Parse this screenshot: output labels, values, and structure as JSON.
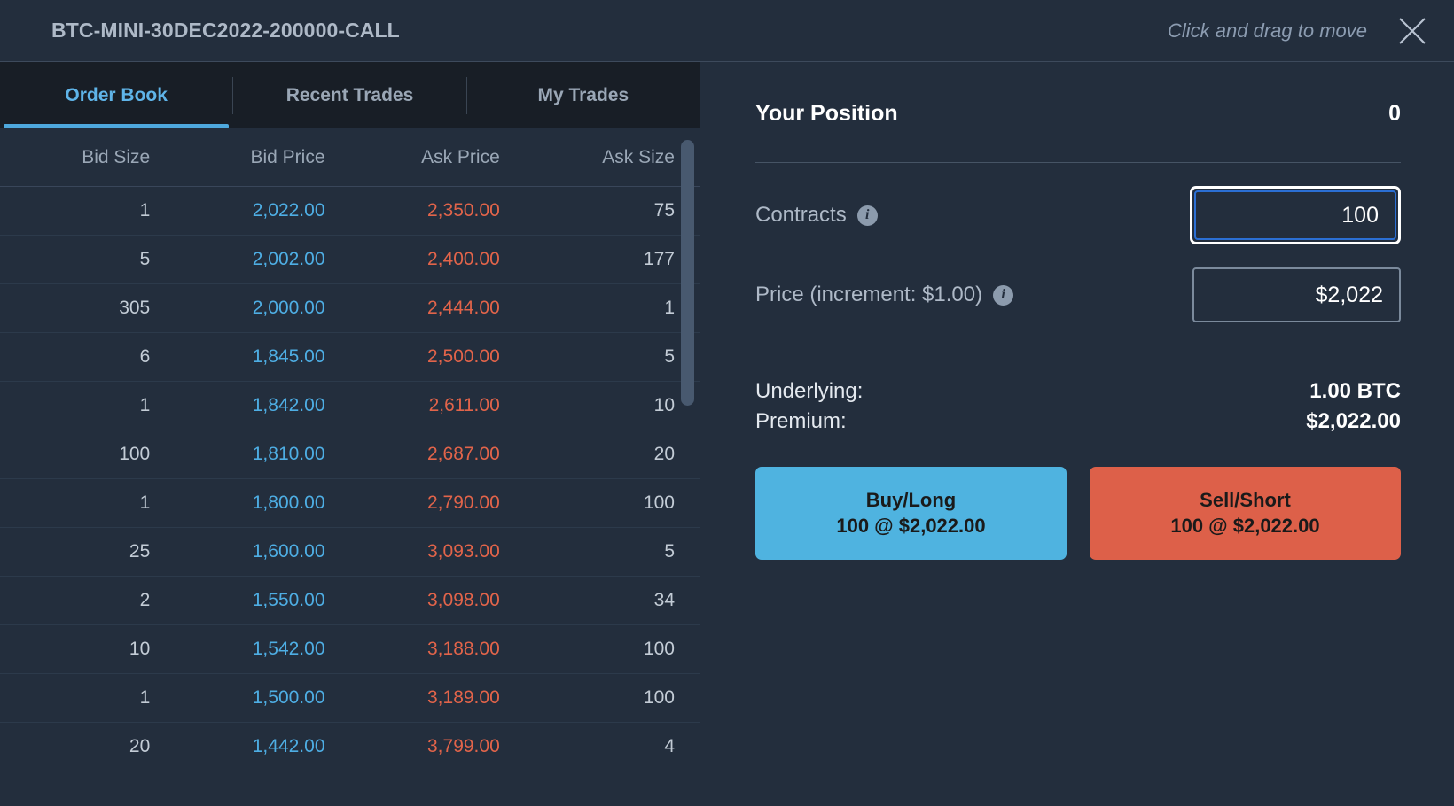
{
  "titlebar": {
    "instrument": "BTC-MINI-30DEC2022-200000-CALL",
    "drag_hint": "Click and drag to move",
    "close_icon": "close-icon"
  },
  "tabs": [
    {
      "label": "Order Book",
      "active": true
    },
    {
      "label": "Recent Trades",
      "active": false
    },
    {
      "label": "My Trades",
      "active": false
    }
  ],
  "order_book": {
    "columns": [
      "Bid Size",
      "Bid Price",
      "Ask Price",
      "Ask Size"
    ],
    "rows": [
      {
        "bid_size": "1",
        "bid_price": "2,022.00",
        "ask_price": "2,350.00",
        "ask_size": "75"
      },
      {
        "bid_size": "5",
        "bid_price": "2,002.00",
        "ask_price": "2,400.00",
        "ask_size": "177"
      },
      {
        "bid_size": "305",
        "bid_price": "2,000.00",
        "ask_price": "2,444.00",
        "ask_size": "1"
      },
      {
        "bid_size": "6",
        "bid_price": "1,845.00",
        "ask_price": "2,500.00",
        "ask_size": "5"
      },
      {
        "bid_size": "1",
        "bid_price": "1,842.00",
        "ask_price": "2,611.00",
        "ask_size": "10"
      },
      {
        "bid_size": "100",
        "bid_price": "1,810.00",
        "ask_price": "2,687.00",
        "ask_size": "20"
      },
      {
        "bid_size": "1",
        "bid_price": "1,800.00",
        "ask_price": "2,790.00",
        "ask_size": "100"
      },
      {
        "bid_size": "25",
        "bid_price": "1,600.00",
        "ask_price": "3,093.00",
        "ask_size": "5"
      },
      {
        "bid_size": "2",
        "bid_price": "1,550.00",
        "ask_price": "3,098.00",
        "ask_size": "34"
      },
      {
        "bid_size": "10",
        "bid_price": "1,542.00",
        "ask_price": "3,188.00",
        "ask_size": "100"
      },
      {
        "bid_size": "1",
        "bid_price": "1,500.00",
        "ask_price": "3,189.00",
        "ask_size": "100"
      },
      {
        "bid_size": "20",
        "bid_price": "1,442.00",
        "ask_price": "3,799.00",
        "ask_size": "4"
      }
    ]
  },
  "ticket": {
    "position_label": "Your Position",
    "position_value": "0",
    "contracts_label": "Contracts",
    "contracts_value": "100",
    "price_label": "Price (increment: $1.00)",
    "price_value": "$2,022",
    "underlying_label": "Underlying:",
    "underlying_value": "1.00 BTC",
    "premium_label": "Premium:",
    "premium_value": "$2,022.00",
    "buy": {
      "line1": "Buy/Long",
      "line2": "100 @ $2,022.00"
    },
    "sell": {
      "line1": "Sell/Short",
      "line2": "100 @ $2,022.00"
    }
  },
  "colors": {
    "bid": "#4eaee4",
    "ask": "#e2644a",
    "accent": "#4ea8dd",
    "buy": "#4fb3e0",
    "sell": "#dd6049",
    "panel_bg": "#232e3d",
    "tabbar_bg": "#181e26"
  }
}
